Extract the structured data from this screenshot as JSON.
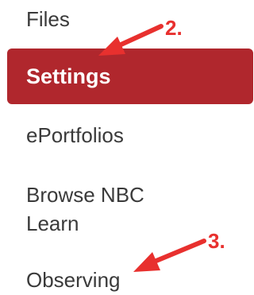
{
  "nav": {
    "items": [
      {
        "label": "Files",
        "active": false
      },
      {
        "label": "Settings",
        "active": true
      },
      {
        "label": "ePortfolios",
        "active": false
      },
      {
        "label": "Browse NBC Learn",
        "active": false
      },
      {
        "label": "Observing",
        "active": false
      }
    ]
  },
  "annotations": {
    "step2": "2.",
    "step3": "3.",
    "color": "#e8302e"
  },
  "colors": {
    "active_bg": "#b0272d",
    "active_text": "#ffffff",
    "text": "#3a3a3a"
  }
}
